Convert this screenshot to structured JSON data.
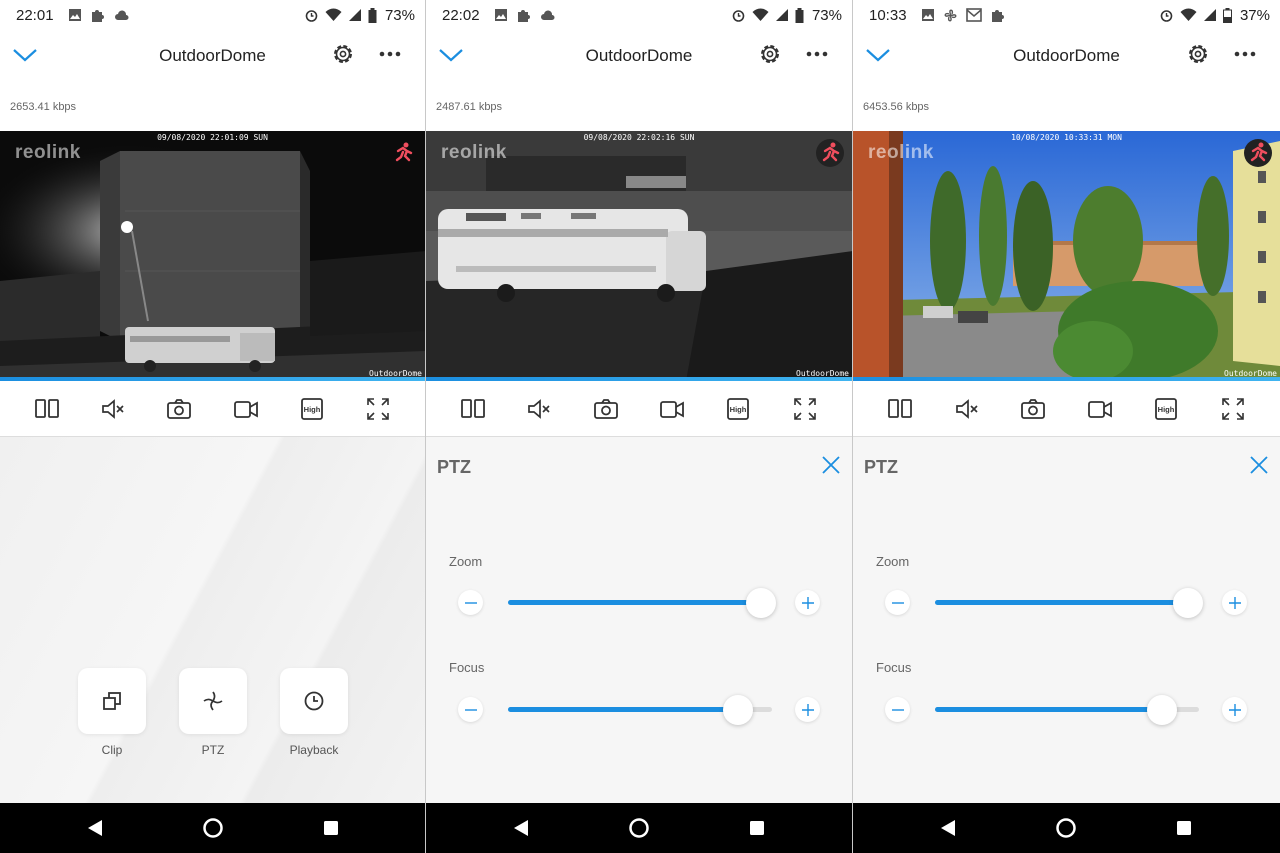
{
  "app": {
    "title": "OutdoorDome",
    "accent": "#1b8ee0"
  },
  "phones": [
    {
      "status": {
        "time": "22:01",
        "battery": "73%"
      },
      "kbps": "2653.41 kbps",
      "video": {
        "timestamp": "09/08/2020 22:01:09 SUN",
        "camera_name": "OutdoorDome",
        "brand": "reolink"
      }
    },
    {
      "status": {
        "time": "22:02",
        "battery": "73%"
      },
      "kbps": "2487.61 kbps",
      "video": {
        "timestamp": "09/08/2020 22:02:16 SUN",
        "camera_name": "OutdoorDome",
        "brand": "reolink"
      }
    },
    {
      "status": {
        "time": "10:33",
        "battery": "37%"
      },
      "kbps": "6453.56 kbps",
      "video": {
        "timestamp": "10/08/2020 10:33:31 MON",
        "camera_name": "OutdoorDome",
        "brand": "reolink"
      }
    }
  ],
  "toolbar": {
    "quality": "High"
  },
  "actions": [
    {
      "label": "Clip",
      "icon": "clip-icon"
    },
    {
      "label": "PTZ",
      "icon": "ptz-icon"
    },
    {
      "label": "Playback",
      "icon": "clock-icon"
    }
  ],
  "ptz": {
    "title": "PTZ",
    "zoom_label": "Zoom",
    "focus_label": "Focus",
    "panels": [
      {
        "zoom": 1.0,
        "focus": 0.87
      },
      {
        "zoom": 1.0,
        "focus": 0.86
      }
    ]
  }
}
